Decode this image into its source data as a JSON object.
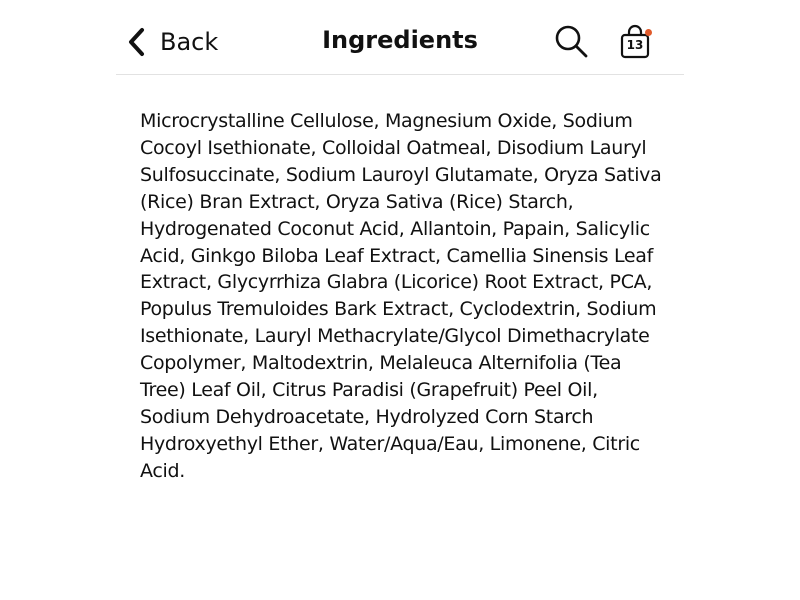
{
  "header": {
    "back_label": "Back",
    "title": "Ingredients",
    "search_icon": "search-icon",
    "cart_icon": "shopping-bag-icon",
    "cart_count": "13",
    "cart_badge_color": "#e05a2b"
  },
  "content": {
    "ingredients": "Microcrystalline Cellulose, Magnesium Oxide, Sodium Cocoyl Isethionate, Colloidal Oatmeal, Disodium Lauryl Sulfosuccinate, Sodium Lauroyl Glutamate, Oryza Sativa (Rice) Bran Extract, Oryza Sativa (Rice) Starch, Hydrogenated Coconut Acid, Allantoin, Papain, Salicylic Acid, Ginkgo Biloba Leaf Extract, Camellia Sinensis Leaf Extract, Glycyrrhiza Glabra (Licorice) Root Extract, PCA, Populus Tremuloides Bark Extract, Cyclodextrin, Sodium Isethionate, Lauryl Methacrylate/Glycol Dimethacrylate Copolymer, Maltodextrin, Melaleuca Alternifolia (Tea Tree) Leaf Oil, Citrus Paradisi (Grapefruit) Peel Oil, Sodium Dehydroacetate, Hydrolyzed Corn Starch Hydroxyethyl Ether, Water/Aqua/Eau, Limonene, Citric Acid."
  }
}
